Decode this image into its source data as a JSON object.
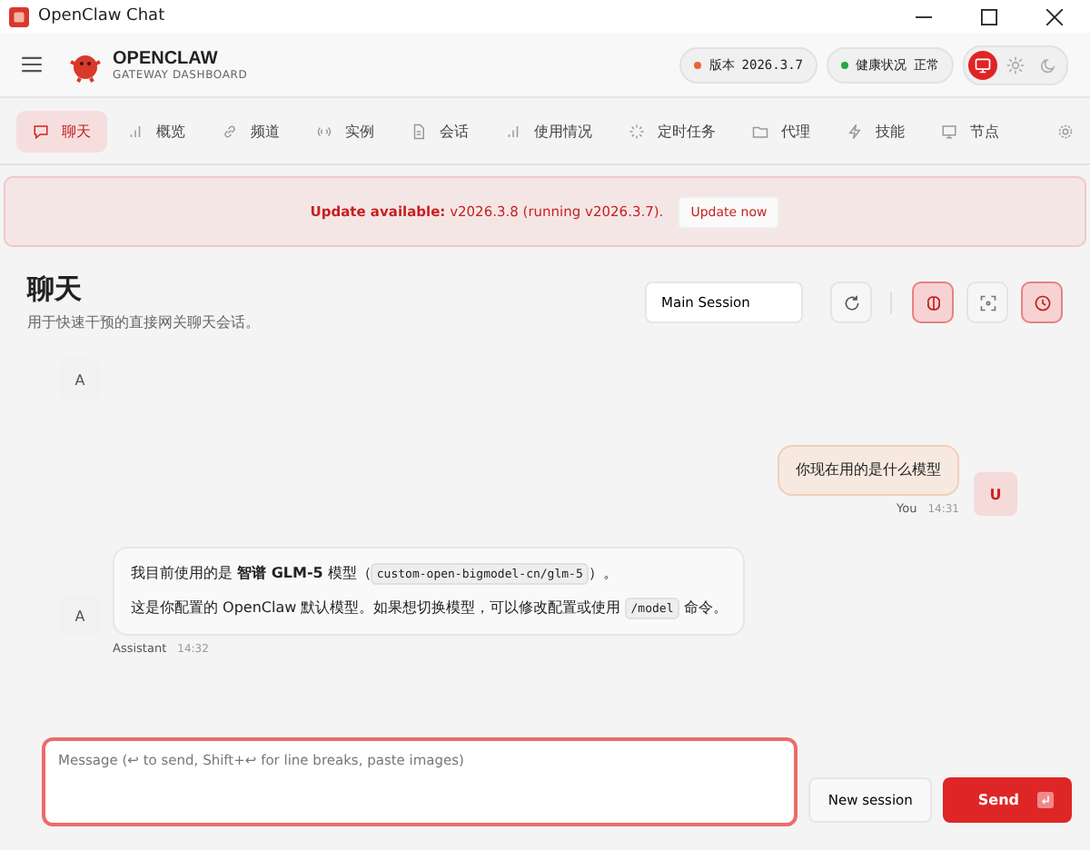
{
  "window": {
    "title": "OpenClaw Chat"
  },
  "header": {
    "brand": "OPENCLAW",
    "subtitle": "GATEWAY DASHBOARD",
    "version": {
      "label": "版本",
      "value": "2026.3.7",
      "color": "#e8643c"
    },
    "health": {
      "label": "健康状况",
      "value": "正常",
      "color": "#22a94a"
    },
    "theme": [
      {
        "kind": "monitor",
        "selected": true
      },
      {
        "kind": "sun",
        "selected": false
      },
      {
        "kind": "moon",
        "selected": false
      }
    ]
  },
  "tabs": [
    {
      "label": "聊天",
      "kind": "chat",
      "selected": true
    },
    {
      "label": "概览",
      "kind": "bars",
      "selected": false
    },
    {
      "label": "频道",
      "kind": "link",
      "selected": false
    },
    {
      "label": "实例",
      "kind": "radio",
      "selected": false
    },
    {
      "label": "会话",
      "kind": "doc",
      "selected": false
    },
    {
      "label": "使用情况",
      "kind": "bars",
      "selected": false
    },
    {
      "label": "定时任务",
      "kind": "spinner",
      "selected": false
    },
    {
      "label": "代理",
      "kind": "folder",
      "selected": false
    },
    {
      "label": "技能",
      "kind": "bolt",
      "selected": false
    },
    {
      "label": "节点",
      "kind": "monitor",
      "selected": false
    }
  ],
  "banner": {
    "text": "**Update available:** v2026.3.8 (running v2026.3.7).",
    "button": "Update now"
  },
  "page": {
    "title": "聊天",
    "subtitle": "用于快速干预的直接网关聊天会话。",
    "session": "Main Session",
    "tools": [
      {
        "kind": "brain",
        "on": true
      },
      {
        "kind": "focus",
        "on": false
      },
      {
        "kind": "clock",
        "on": true
      }
    ]
  },
  "messages": [
    {
      "kind": "stub",
      "avatar": "A"
    },
    {
      "kind": "user",
      "avatar": "U",
      "paragraphs": [
        [
          {
            "kind": "text",
            "text": "你现在用的是什么模型"
          }
        ]
      ],
      "sender": "You",
      "time": "14:31"
    },
    {
      "kind": "assistant",
      "avatar": "A",
      "paragraphs": [
        [
          {
            "kind": "text",
            "text": "我目前使用的是 **智谱 GLM-5** 模型（"
          },
          {
            "kind": "code",
            "text": "custom-open-bigmodel-cn/glm-5"
          },
          {
            "kind": "text",
            "text": "）。"
          }
        ],
        [
          {
            "kind": "text",
            "text": "这是你配置的 OpenClaw 默认模型。如果想切换模型，可以修改配置或使用 "
          },
          {
            "kind": "code",
            "text": "/model"
          },
          {
            "kind": "text",
            "text": " 命令。"
          }
        ]
      ],
      "sender": "Assistant",
      "time": "14:32"
    }
  ],
  "composer": {
    "placeholder": "Message (↩ to send, Shift+↩ for line breaks, paste images)",
    "new_session": "New session",
    "send": "Send"
  }
}
